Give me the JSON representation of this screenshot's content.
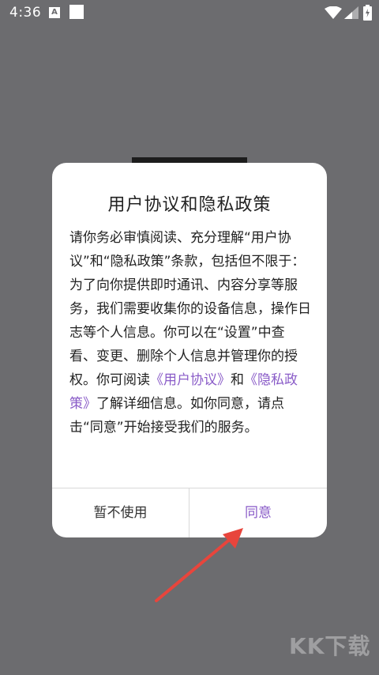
{
  "status_bar": {
    "time": "4:36",
    "a_icon_text": "A"
  },
  "dialog": {
    "title": "用户协议和隐私政策",
    "body_part1": "请你务必审慎阅读、充分理解“用户协议”和“隐私政策”条款，包括但不限于：为了向你提供即时通讯、内容分享等服务，我们需要收集你的设备信息，操作日志等个人信息。你可以在“设置”中查看、变更、删除个人信息并管理你的授权。你可阅读",
    "user_agreement_link": "《用户协议》",
    "and_text": "和",
    "privacy_policy_link": "《隐私政策》",
    "body_part2": "了解详细信息。如你同意，请点击“同意”开始接受我们的服务。",
    "decline_button": "暂不使用",
    "agree_button": "同意"
  },
  "watermark": "KK下载",
  "colors": {
    "accent": "#8a5cc8",
    "overlay": "#6c6c6f",
    "arrow": "#e8453c"
  }
}
